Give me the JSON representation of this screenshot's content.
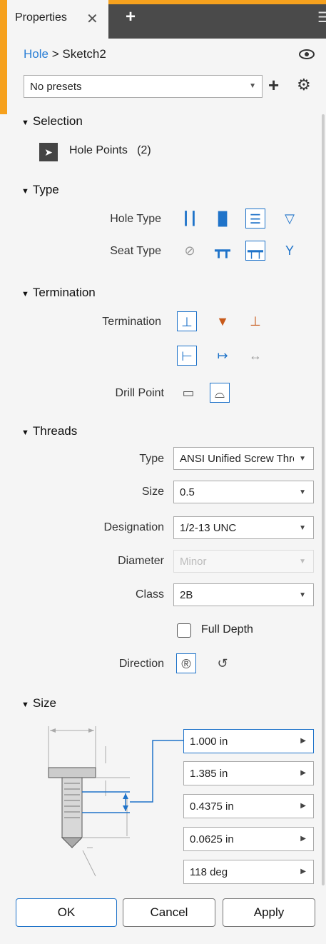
{
  "tab": {
    "title": "Properties",
    "close": "✕",
    "add": "+",
    "menu": "☰"
  },
  "breadcrumb": {
    "link": "Hole",
    "separator": ">",
    "current": "Sketch2",
    "eye": "👁"
  },
  "presets": {
    "value": "No presets",
    "add": "+",
    "settings": "⚙"
  },
  "selection": {
    "header": "Selection",
    "item_label": "Hole Points",
    "count": "(2)"
  },
  "type": {
    "header": "Type",
    "hole_type_label": "Hole Type",
    "seat_type_label": "Seat Type"
  },
  "termination": {
    "header": "Termination",
    "termination_label": "Termination",
    "drill_point_label": "Drill Point"
  },
  "threads": {
    "header": "Threads",
    "type_label": "Type",
    "type_value": "ANSI Unified Screw Threads",
    "size_label": "Size",
    "size_value": "0.5",
    "designation_label": "Designation",
    "designation_value": "1/2-13 UNC",
    "diameter_label": "Diameter",
    "diameter_value": "Minor",
    "class_label": "Class",
    "class_value": "2B",
    "full_depth_label": "Full Depth",
    "direction_label": "Direction"
  },
  "size": {
    "header": "Size",
    "values": [
      "1.000 in",
      "1.385 in",
      "0.4375 in",
      "0.0625 in",
      "118 deg"
    ]
  },
  "buttons": {
    "ok": "OK",
    "cancel": "Cancel",
    "apply": "Apply"
  },
  "colors": {
    "accent": "#1f73c9",
    "orange": "#f6a11d",
    "tabbar": "#4a4a4a"
  }
}
